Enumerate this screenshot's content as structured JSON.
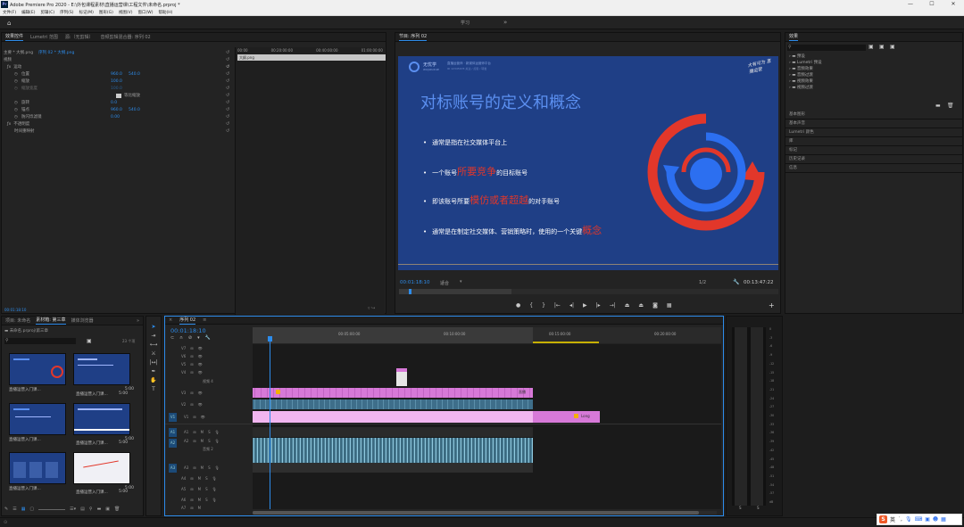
{
  "window": {
    "title": "Adobe Premiere Pro 2020 - E:\\外包课程素材\\直播运营课\\工程文件\\未命名.prproj *",
    "minimize": "—",
    "maximize": "☐",
    "close": "✕"
  },
  "menu": [
    "文件(F)",
    "编辑(E)",
    "剪辑(C)",
    "序列(S)",
    "标记(M)",
    "图形(G)",
    "视图(V)",
    "窗口(W)",
    "帮助(H)"
  ],
  "workspace": {
    "label": "学习",
    "more": "»"
  },
  "effect_controls": {
    "tabs": [
      "效果控件",
      "Lumetri 范围",
      "源:（无剪辑）",
      "音频剪辑混合器: 序列 02"
    ],
    "source": "主要 * 大纲.png",
    "sequence": "序列 02 * 大纲.png",
    "timecodes": [
      "00:00",
      "00:20:00:00",
      "00:40:00:00",
      "01:00:00:00"
    ],
    "clip_label": "大纲.png",
    "sections": {
      "video": "视频",
      "motion": "运动",
      "opacity": "不透明度",
      "time_remap": "时间重映射"
    },
    "params": [
      {
        "name": "位置",
        "v1": "960.0",
        "v2": "540.0"
      },
      {
        "name": "缩放",
        "v1": "100.0",
        "v2": ""
      },
      {
        "name": "缩放宽度",
        "v1": "100.0",
        "v2": ""
      },
      {
        "name": "等比缩放",
        "v1": "",
        "v2": ""
      },
      {
        "name": "旋转",
        "v1": "0.0",
        "v2": ""
      },
      {
        "name": "锚点",
        "v1": "960.0",
        "v2": "540.0"
      },
      {
        "name": "防闪烁滤镜",
        "v1": "0.00",
        "v2": ""
      }
    ],
    "footer_time": "00:01:18:10"
  },
  "program": {
    "title": "节目: 序列 02",
    "timecode": "00:01:18:10",
    "fit": "适合",
    "quality": "1/2",
    "duration": "00:13:47:22",
    "slide": {
      "brand": "无忧学",
      "brand_sub": "wuyouxue",
      "tagline": "直播运营师 · 新媒体运营师平台",
      "meta": "ID 12345678        关注 / 点赞 / 转发",
      "signature": "大有可为 直播运营",
      "heading": "对标账号的定义和概念",
      "bullets": [
        {
          "pre": "通常是指在社交媒体平台上",
          "hl": "",
          "post": ""
        },
        {
          "pre": "一个账号",
          "hl": "所要竞争",
          "post": "的目标账号"
        },
        {
          "pre": "即该账号所要",
          "hl": "模仿或者超越",
          "post": "的对手账号"
        },
        {
          "pre": "通常是在制定社交媒体、营销策略时，使用的一个关键",
          "hl": "概念",
          "post": ""
        }
      ],
      "colors": {
        "bg": "#1f3f86",
        "accent": "#e2372a",
        "heading": "#5b8ff0",
        "circle": "#2c6ff0"
      }
    }
  },
  "effects_panel": {
    "title": "效果",
    "items": [
      "预设",
      "Lumetri 预设",
      "音频效果",
      "音频过渡",
      "视频效果",
      "视频过渡"
    ],
    "panels": [
      "基本图形",
      "基本声音",
      "Lumetri 颜色",
      "库",
      "标记",
      "历史记录",
      "信息"
    ]
  },
  "project": {
    "tabs": [
      "项目: 未命名",
      "素材箱: 第三章",
      "媒体浏览器"
    ],
    "path": "未命名.prproj\\第三章",
    "count": "23 个项",
    "items": [
      {
        "name": "直播运营入门课...",
        "dur": "5:00"
      },
      {
        "name": "直播运营入门课...",
        "dur": "5:00"
      },
      {
        "name": "直播运营入门课...",
        "dur": "5:00"
      },
      {
        "name": "直播运营入门课...",
        "dur": "5:00"
      },
      {
        "name": "直播运营入门课...",
        "dur": "5:00"
      },
      {
        "name": "直播运营入门课...",
        "dur": "5:00"
      }
    ]
  },
  "timeline": {
    "title": "序列 02",
    "timecode": "00:01:18:10",
    "ruler": [
      "00:05:00:00",
      "00:10:00:00",
      "00:15:00:00",
      "00:20:00:00"
    ],
    "video_tracks": [
      "V7",
      "V6",
      "V5",
      "V4",
      "V3",
      "V2",
      "V1"
    ],
    "audio_tracks": [
      "A1",
      "A2",
      "A3",
      "A4",
      "A5",
      "A6",
      "A7"
    ],
    "track_names": {
      "v4": "视频 4",
      "a2": "音频 2"
    },
    "clips": {
      "v3": "直播",
      "v1": "Long"
    }
  },
  "meter_scale": [
    "0",
    "-3",
    "-6",
    "-9",
    "-12",
    "-15",
    "-18",
    "-21",
    "-24",
    "-27",
    "-30",
    "-33",
    "-36",
    "-39",
    "-42",
    "-45",
    "-48",
    "-51",
    "-54",
    "-57",
    "dB"
  ],
  "meter_footer": [
    "S",
    "S"
  ],
  "ime": {
    "logo": "S",
    "lang": "英"
  }
}
